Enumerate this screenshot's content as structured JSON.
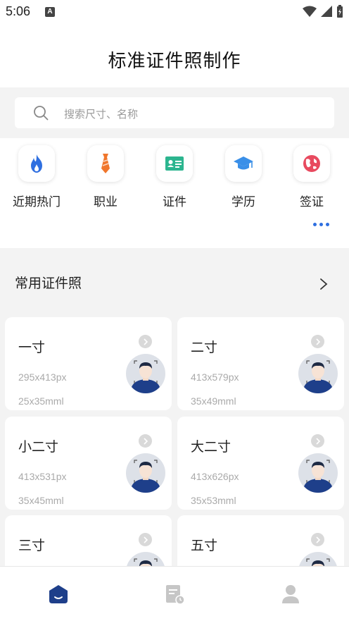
{
  "status_bar": {
    "time": "5:06",
    "notification_badge": "A"
  },
  "header": {
    "title": "标准证件照制作"
  },
  "search": {
    "placeholder": "搜索尺寸、名称"
  },
  "categories": [
    {
      "label": "近期热门",
      "icon": "flame-icon",
      "color": "#2f6fe0"
    },
    {
      "label": "职业",
      "icon": "necktie-icon",
      "color": "#f0762c"
    },
    {
      "label": "证件",
      "icon": "id-card-icon",
      "color": "#2cb58f"
    },
    {
      "label": "学历",
      "icon": "graduation-cap-icon",
      "color": "#3a8fe8"
    },
    {
      "label": "签证",
      "icon": "globe-icon",
      "color": "#e84a5f"
    }
  ],
  "section": {
    "title": "常用证件照"
  },
  "photo_sizes": [
    {
      "name": "一寸",
      "pixels": "295x413px",
      "mm": "25x35mml"
    },
    {
      "name": "二寸",
      "pixels": "413x579px",
      "mm": "35x49mml"
    },
    {
      "name": "小二寸",
      "pixels": "413x531px",
      "mm": "35x45mml"
    },
    {
      "name": "大二寸",
      "pixels": "413x626px",
      "mm": "35x53mml"
    },
    {
      "name": "三寸",
      "pixels": "",
      "mm": ""
    },
    {
      "name": "五寸",
      "pixels": "",
      "mm": ""
    }
  ],
  "tabbar": [
    {
      "icon": "home-icon",
      "active": true
    },
    {
      "icon": "orders-icon",
      "active": false
    },
    {
      "icon": "profile-icon",
      "active": false
    }
  ],
  "colors": {
    "accent": "#2f6fe0",
    "tab_active": "#1e3f8a",
    "tab_inactive": "#c6c6c6"
  }
}
